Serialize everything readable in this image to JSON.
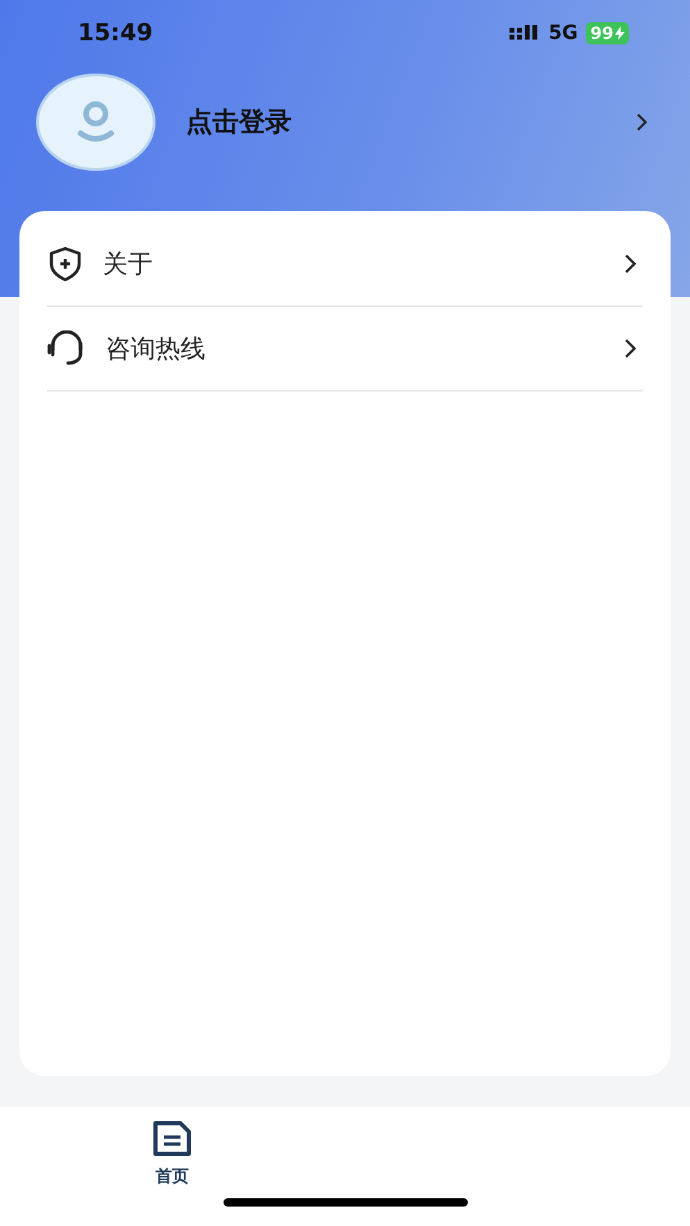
{
  "status_bar": {
    "time": "15:49",
    "network": "5G",
    "battery": "99"
  },
  "profile": {
    "login_label": "点击登录"
  },
  "menu": [
    {
      "kind": "shield",
      "label": "关于"
    },
    {
      "kind": "headset",
      "label": "咨询热线"
    }
  ],
  "tab_bar": [
    {
      "label": "首页",
      "selected": true
    }
  ]
}
